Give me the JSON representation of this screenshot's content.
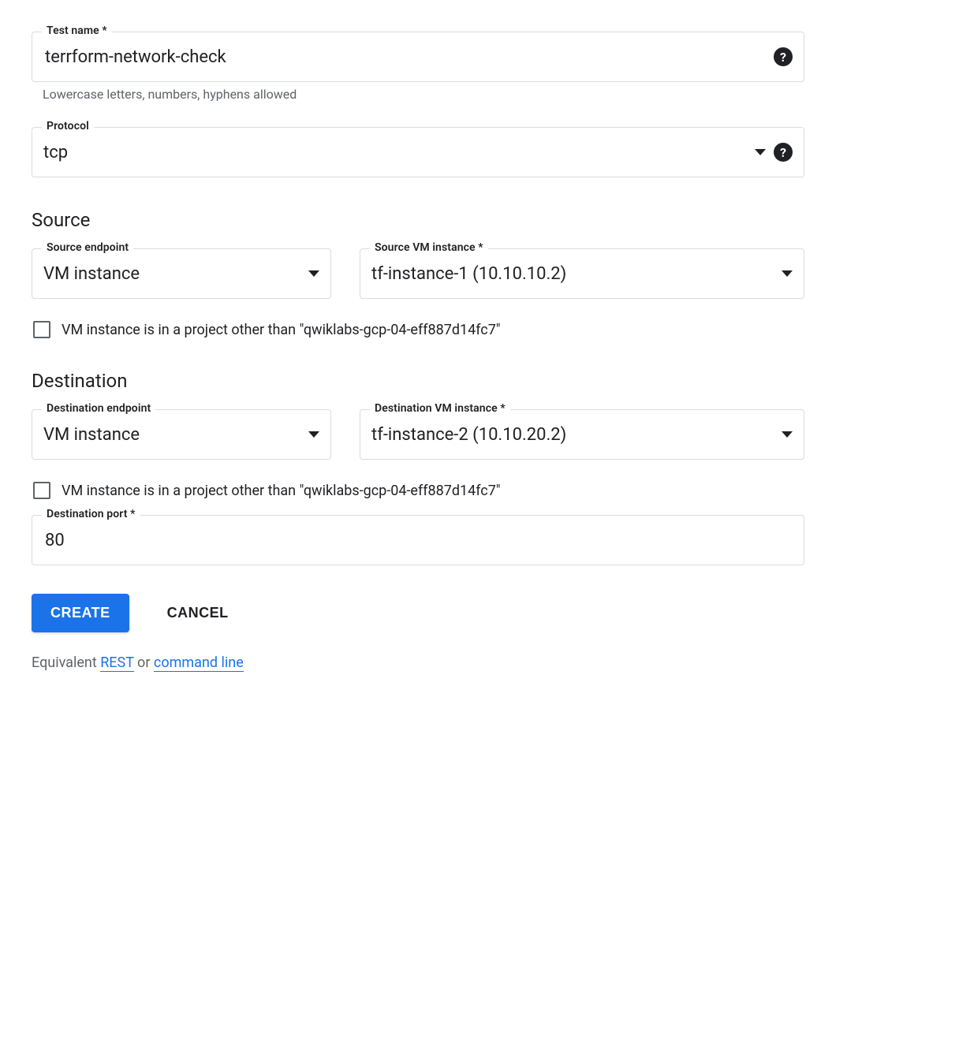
{
  "testName": {
    "label": "Test name *",
    "value": "terrform-network-check",
    "helper": "Lowercase letters, numbers, hyphens allowed"
  },
  "protocol": {
    "label": "Protocol",
    "value": "tcp"
  },
  "source": {
    "heading": "Source",
    "endpoint": {
      "label": "Source endpoint",
      "value": "VM instance"
    },
    "vm": {
      "label": "Source VM instance *",
      "value": "tf-instance-1 (10.10.10.2)"
    },
    "otherProject": {
      "label": "VM instance is in a project other than \"qwiklabs-gcp-04-eff887d14fc7\""
    }
  },
  "destination": {
    "heading": "Destination",
    "endpoint": {
      "label": "Destination endpoint",
      "value": "VM instance"
    },
    "vm": {
      "label": "Destination VM instance *",
      "value": "tf-instance-2 (10.10.20.2)"
    },
    "otherProject": {
      "label": "VM instance is in a project other than \"qwiklabs-gcp-04-eff887d14fc7\""
    },
    "port": {
      "label": "Destination port *",
      "value": "80"
    }
  },
  "buttons": {
    "create": "CREATE",
    "cancel": "CANCEL"
  },
  "equivalent": {
    "prefix": "Equivalent ",
    "rest": "REST",
    "or": " or ",
    "cli": "command line"
  }
}
